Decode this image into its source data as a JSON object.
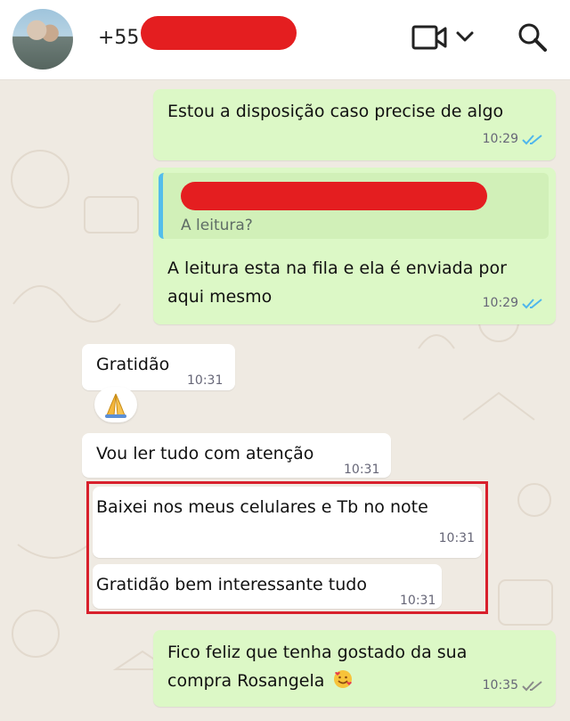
{
  "header": {
    "contact_prefix": "+55",
    "avatar": "avatar-photo",
    "icons": {
      "video": "video-call-icon",
      "dropdown": "chevron-down-icon",
      "search": "search-icon"
    }
  },
  "colors": {
    "outgoing": "#dcf8c6",
    "incoming": "#ffffff",
    "read_ticks": "#4fb6ec",
    "delivered_ticks": "#8a8a8a",
    "redaction": "#e41e20",
    "highlight": "#d8202c",
    "quote_bar": "#53bdeb"
  },
  "messages": [
    {
      "text": "Estou a disposição caso precise de algo",
      "time": "10:29",
      "ticks": "read-ticks-icon"
    },
    {
      "quoted": "A leitura?",
      "line1": "A leitura esta na fila e ela é enviada por",
      "line2": "aqui mesmo",
      "time": "10:29",
      "ticks": "read-ticks-icon"
    },
    {
      "text": "Gratidão",
      "time": "10:31",
      "reaction": "folded-hands-emoji"
    },
    {
      "text": "Vou ler tudo com atenção",
      "time": "10:31"
    },
    {
      "text": "Baixei nos meus celulares e Tb no note",
      "time": "10:31"
    },
    {
      "text": "Gratidão bem interessante tudo",
      "time": "10:31"
    },
    {
      "line1": "Fico feliz que tenha gostado da sua",
      "line2": "compra Rosangela",
      "emoji": "smiling-face-with-hearts-emoji",
      "time": "10:35",
      "ticks": "delivered-ticks-icon"
    }
  ]
}
